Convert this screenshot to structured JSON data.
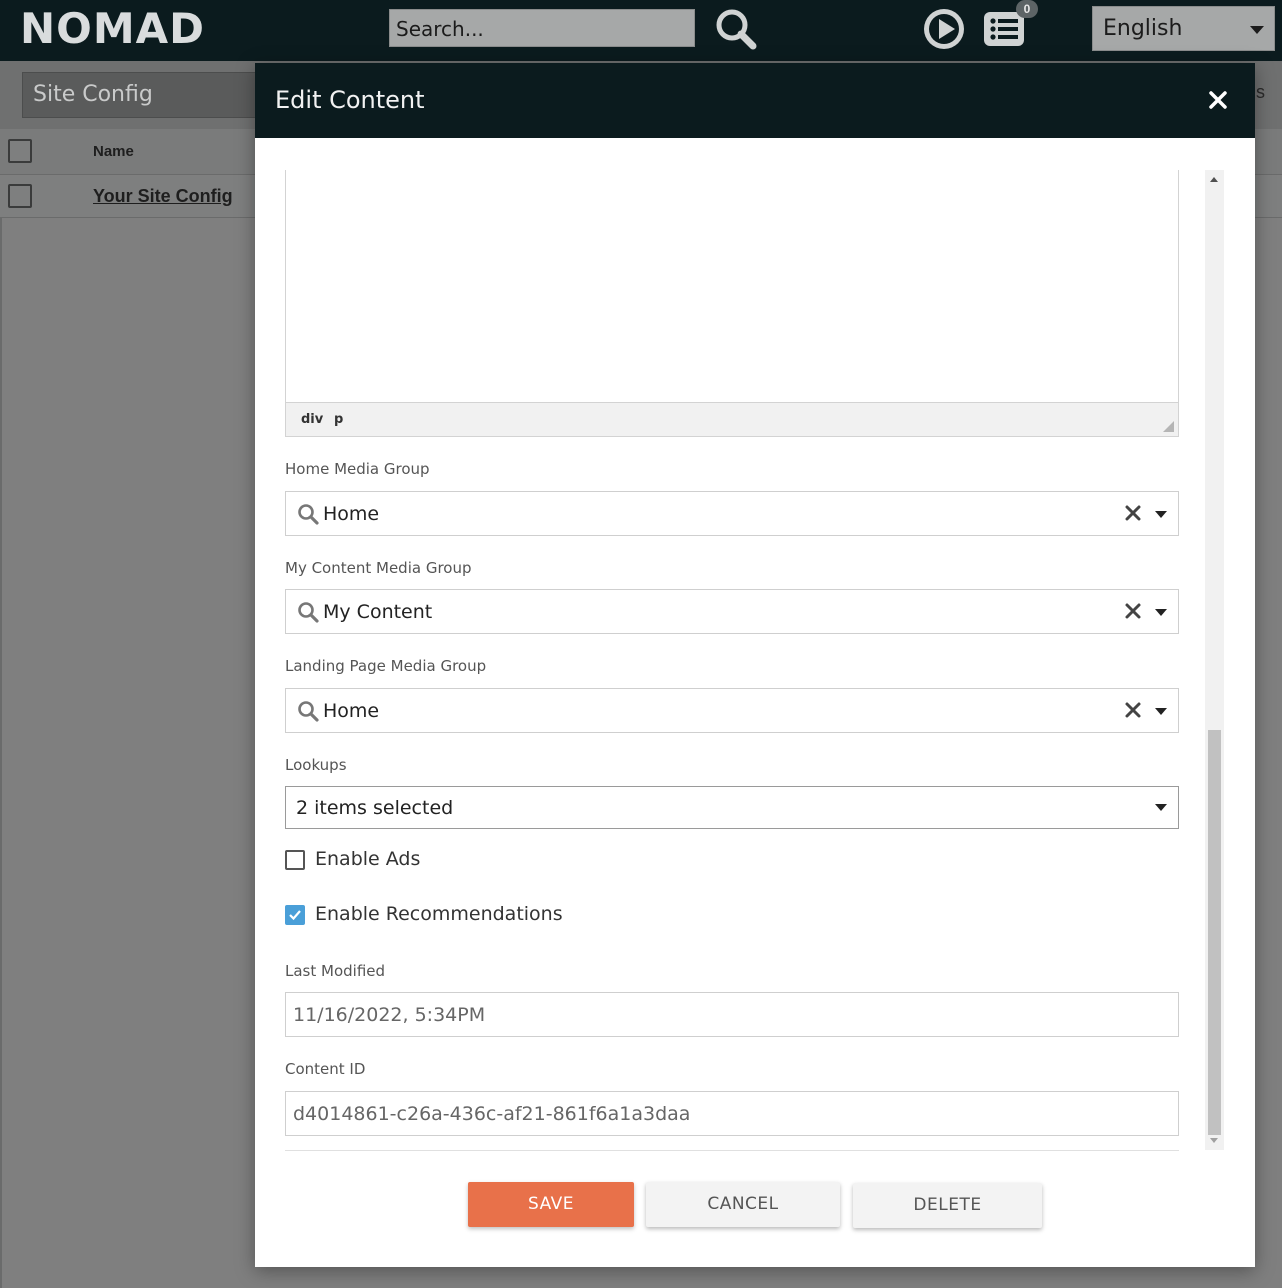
{
  "app": {
    "logo": "NOMAD",
    "search_placeholder": "Search...",
    "notification_count": "0",
    "language": "English"
  },
  "background": {
    "site_select": "Site Config",
    "right_partial_text": "s",
    "table": {
      "header_name": "Name",
      "rows": [
        "Your Site Config"
      ]
    }
  },
  "modal": {
    "title": "Edit Content",
    "editor": {
      "path": [
        "div",
        "p"
      ]
    },
    "fields": {
      "home_media_group": {
        "label": "Home Media Group",
        "value": "Home"
      },
      "my_content_media_group": {
        "label": "My Content Media Group",
        "value": "My Content"
      },
      "landing_page_media_group": {
        "label": "Landing Page Media Group",
        "value": "Home"
      },
      "lookups": {
        "label": "Lookups",
        "value": "2 items selected"
      },
      "enable_ads": {
        "label": "Enable Ads",
        "checked": false
      },
      "enable_recommendations": {
        "label": "Enable Recommendations",
        "checked": true
      },
      "last_modified": {
        "label": "Last Modified",
        "value": "11/16/2022, 5:34PM"
      },
      "content_id": {
        "label": "Content ID",
        "value": "d4014861-c26a-436c-af21-861f6a1a3daa"
      }
    },
    "buttons": {
      "save": "SAVE",
      "cancel": "CANCEL",
      "delete": "DELETE"
    }
  },
  "colors": {
    "topbar": "#0b1b1e",
    "accent_save": "#e8714a",
    "checkbox_checked": "#4a9fd8"
  }
}
